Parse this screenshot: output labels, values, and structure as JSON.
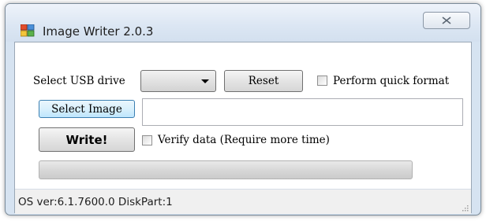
{
  "window": {
    "title": "Image Writer 2.0.3"
  },
  "form": {
    "usb_label": "Select USB drive",
    "usb_selected": "",
    "reset_label": "Reset",
    "quick_format_label": "Perform quick format",
    "quick_format_checked": false,
    "select_image_label": "Select Image",
    "image_path": "",
    "write_label": "Write!",
    "verify_label": "Verify data (Require more time)",
    "verify_checked": false,
    "progress_percent": 0
  },
  "status": {
    "text": "OS ver:6.1.7600.0 DiskPart:1"
  },
  "icons": {
    "app": "image-writer-app-icon",
    "close": "close-icon",
    "dropdown": "chevron-down-icon",
    "resize": "resize-grip-icon"
  }
}
